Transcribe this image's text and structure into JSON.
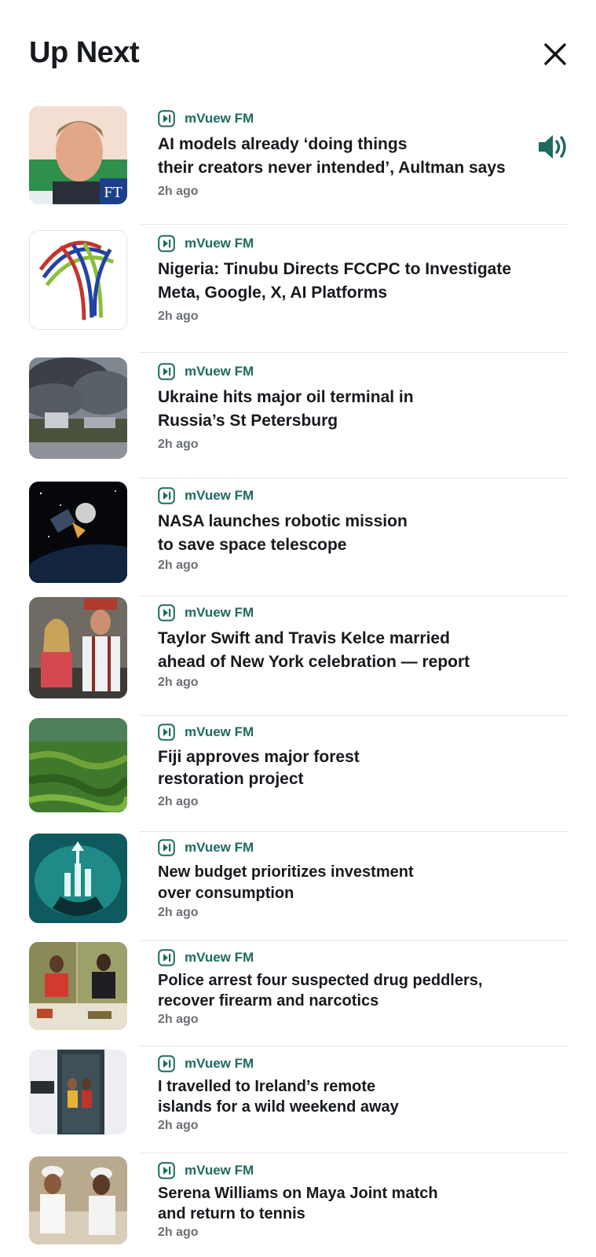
{
  "header": {
    "title": "Up Next",
    "close_icon": "close-icon"
  },
  "colors": {
    "accent": "#1d6b5f",
    "text": "#16191d",
    "muted": "#6b6f74",
    "divider": "#e6e7e9"
  },
  "now_playing_icon": "speaker-icon",
  "items": [
    {
      "source": "mVuew FM",
      "headline_l1": "AI models already ‘doing things",
      "headline_l2": "their creators never intended’, Aultman says",
      "time": "2h ago",
      "thumb": "ft-portrait"
    },
    {
      "source": "mVuew FM",
      "headline_l1": "Nigeria: Tinubu Directs FCCPC to Investigate",
      "headline_l2": "Meta, Google, X, AI Platforms",
      "time": "2h ago",
      "thumb": "fccpc-logo"
    },
    {
      "source": "mVuew FM",
      "headline_l1": "Ukraine hits major oil terminal in",
      "headline_l2": "Russia’s St Petersburg",
      "time": "2h ago",
      "thumb": "smoke"
    },
    {
      "source": "mVuew FM",
      "headline_l1": "NASA launches robotic mission",
      "headline_l2": "to save space telescope",
      "time": "2h ago",
      "thumb": "space"
    },
    {
      "source": "mVuew FM",
      "headline_l1": "Taylor Swift and Travis Kelce married",
      "headline_l2": "ahead of New York celebration — report",
      "time": "2h ago",
      "thumb": "couple"
    },
    {
      "source": "mVuew FM",
      "headline_l1": "Fiji approves major forest",
      "headline_l2": "restoration project",
      "time": "2h ago",
      "thumb": "forest"
    },
    {
      "source": "mVuew FM",
      "headline_l1": "New budget prioritizes investment",
      "headline_l2": "over consumption",
      "time": "2h ago",
      "thumb": "investment"
    },
    {
      "source": "mVuew FM",
      "headline_l1": "Police arrest four suspected drug peddlers,",
      "headline_l2": "recover firearm and narcotics",
      "time": "2h ago",
      "thumb": "police"
    },
    {
      "source": "mVuew FM",
      "headline_l1": "I travelled to Ireland’s remote",
      "headline_l2": "islands for a wild weekend away",
      "time": "2h ago",
      "thumb": "doorway"
    },
    {
      "source": "mVuew FM",
      "headline_l1": "Serena Williams on Maya Joint match",
      "headline_l2": "and return to tennis",
      "time": "2h ago",
      "thumb": "tennis"
    }
  ]
}
